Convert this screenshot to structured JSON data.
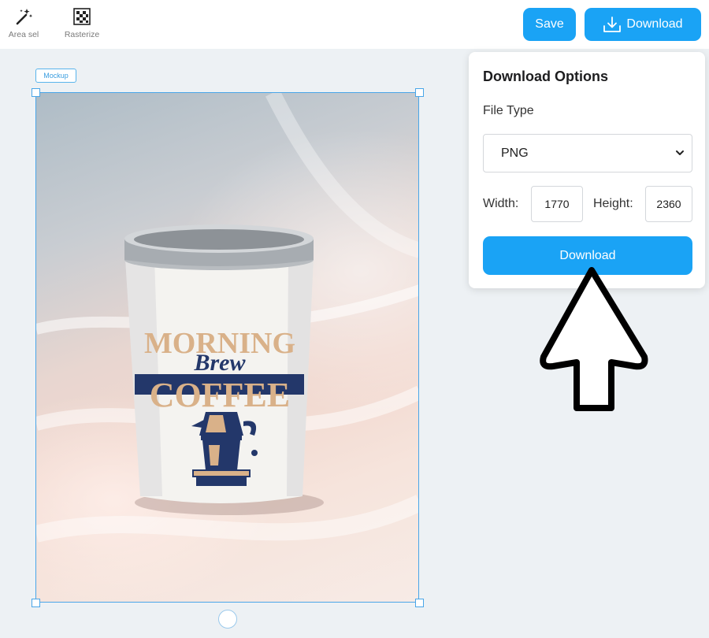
{
  "toolbar": {
    "tools": [
      {
        "label": "Area sel",
        "icon": "magic-wand-icon"
      },
      {
        "label": "Rasterize",
        "icon": "rasterize-icon"
      }
    ],
    "save_label": "Save",
    "download_label": "Download",
    "download_icon": "download-icon"
  },
  "canvas": {
    "layer_tag": "Mockup",
    "image": "cup-mockup-image"
  },
  "download_panel": {
    "title": "Download Options",
    "file_type_label": "File Type",
    "file_type_value": "PNG",
    "width_label": "Width:",
    "width_value": "1770",
    "height_label": "Height:",
    "height_value": "2360",
    "download_label": "Download"
  },
  "colors": {
    "accent": "#1aa3f5",
    "selection": "#4aa6e8",
    "canvas_bg": "#edf1f4"
  }
}
